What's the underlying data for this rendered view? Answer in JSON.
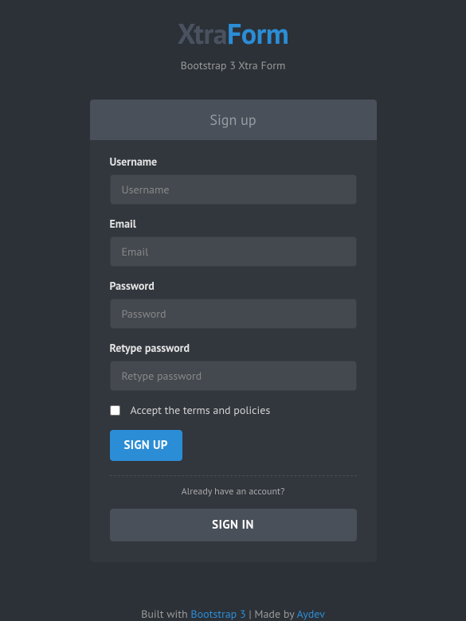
{
  "header": {
    "logo_part1": "Xtra",
    "logo_part2": "Form",
    "tagline": "Bootstrap 3 Xtra Form"
  },
  "card": {
    "title": "Sign up"
  },
  "form": {
    "username": {
      "label": "Username",
      "placeholder": "Username",
      "value": ""
    },
    "email": {
      "label": "Email",
      "placeholder": "Email",
      "value": ""
    },
    "password": {
      "label": "Password",
      "placeholder": "Password",
      "value": ""
    },
    "retype_password": {
      "label": "Retype password",
      "placeholder": "Retype password",
      "value": ""
    },
    "terms": {
      "label": "Accept the terms and policies"
    },
    "submit": "SIGN UP"
  },
  "already": {
    "text": "Already have an account?",
    "button": "SIGN IN"
  },
  "footer": {
    "built_with": "Built with ",
    "link1": "Bootstrap 3",
    "separator": " | Made by ",
    "link2": "Aydev"
  }
}
